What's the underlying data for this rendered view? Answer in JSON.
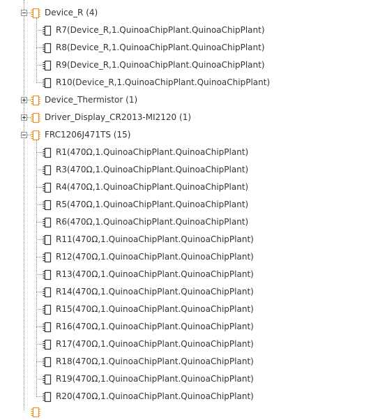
{
  "tree": {
    "groups": [
      {
        "label": "Device_R",
        "count": "(4)",
        "expanded": true,
        "top_cut": true,
        "children": [
          "R7(Device_R,1.QuinoaChipPlant.QuinoaChipPlant)",
          "R8(Device_R,1.QuinoaChipPlant.QuinoaChipPlant)",
          "R9(Device_R,1.QuinoaChipPlant.QuinoaChipPlant)",
          "R10(Device_R,1.QuinoaChipPlant.QuinoaChipPlant)"
        ]
      },
      {
        "label": "Device_Thermistor",
        "count": "(1)",
        "expanded": false,
        "children": []
      },
      {
        "label": "Driver_Display_CR2013-MI2120",
        "count": "(1)",
        "expanded": false,
        "children": []
      },
      {
        "label": "FRC1206J471TS",
        "count": "(15)",
        "expanded": true,
        "children": [
          "R1(470Ω,1.QuinoaChipPlant.QuinoaChipPlant)",
          "R3(470Ω,1.QuinoaChipPlant.QuinoaChipPlant)",
          "R4(470Ω,1.QuinoaChipPlant.QuinoaChipPlant)",
          "R5(470Ω,1.QuinoaChipPlant.QuinoaChipPlant)",
          "R6(470Ω,1.QuinoaChipPlant.QuinoaChipPlant)",
          "R11(470Ω,1.QuinoaChipPlant.QuinoaChipPlant)",
          "R12(470Ω,1.QuinoaChipPlant.QuinoaChipPlant)",
          "R13(470Ω,1.QuinoaChipPlant.QuinoaChipPlant)",
          "R14(470Ω,1.QuinoaChipPlant.QuinoaChipPlant)",
          "R15(470Ω,1.QuinoaChipPlant.QuinoaChipPlant)",
          "R16(470Ω,1.QuinoaChipPlant.QuinoaChipPlant)",
          "R17(470Ω,1.QuinoaChipPlant.QuinoaChipPlant)",
          "R18(470Ω,1.QuinoaChipPlant.QuinoaChipPlant)",
          "R19(470Ω,1.QuinoaChipPlant.QuinoaChipPlant)",
          "R20(470Ω,1.QuinoaChipPlant.QuinoaChipPlant)"
        ]
      }
    ],
    "colors": {
      "group_icon": "#e8902a",
      "part_icon": "#333333",
      "connector": "#8a8a8a",
      "text": "#333333"
    },
    "icons": {
      "group": "component-group-icon",
      "part": "component-icon",
      "expand": "plus-box-icon",
      "collapse": "minus-box-icon"
    }
  }
}
